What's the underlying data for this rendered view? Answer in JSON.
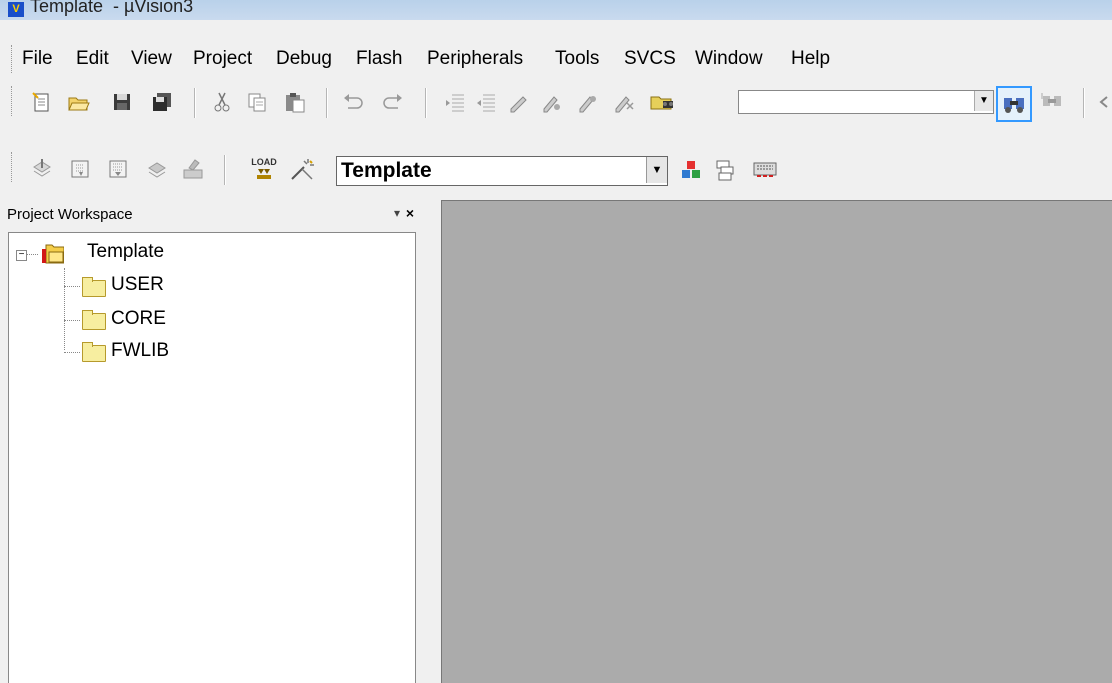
{
  "window": {
    "title": "Template  - µVision3"
  },
  "menu": [
    "File",
    "Edit",
    "View",
    "Project",
    "Debug",
    "Flash",
    "Peripherals",
    "Tools",
    "SVCS",
    "Window",
    "Help"
  ],
  "toolbar1": {
    "icons": [
      "new-file-icon",
      "open-file-icon",
      "save-icon",
      "save-all-icon",
      "cut-icon",
      "copy-icon",
      "paste-icon",
      "undo-icon",
      "redo-icon",
      "indent-icon",
      "unindent-icon",
      "toggle-bookmark-icon",
      "next-bookmark-icon",
      "prev-bookmark-icon",
      "clear-bookmarks-icon",
      "find-in-files-icon",
      "find-icon",
      "incremental-find-icon"
    ],
    "find_value": ""
  },
  "toolbar2": {
    "target": "Template",
    "load_label": "LOAD"
  },
  "workspace": {
    "header": "Project Workspace",
    "root": "Template",
    "groups": [
      "USER",
      "CORE",
      "FWLIB"
    ]
  },
  "colors": {
    "editor_bg": "#ababab",
    "highlight": "#3399ff"
  }
}
